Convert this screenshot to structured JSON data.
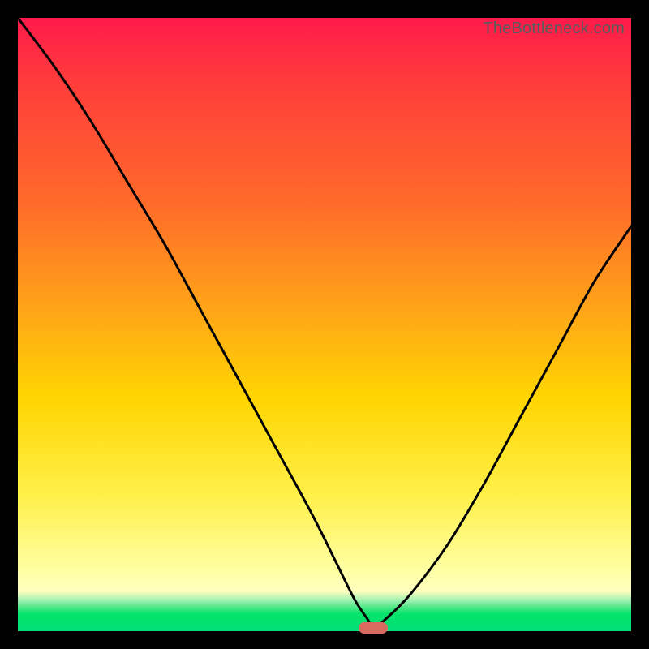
{
  "watermark_text": "TheBottleneck.com",
  "colors": {
    "frame": "#000000",
    "curve": "#000000",
    "marker": "#d96a60",
    "gradient_stops": [
      "#ff1a4b",
      "#ff3b3b",
      "#ff6a2a",
      "#ffa617",
      "#ffd500",
      "#fff04a",
      "#ffffa3",
      "#ffffbe",
      "#9ef0b0",
      "#49e884",
      "#06e46a",
      "#00df78"
    ]
  },
  "chart_data": {
    "type": "line",
    "title": "",
    "xlabel": "",
    "ylabel": "",
    "xlim": [
      0,
      100
    ],
    "ylim": [
      0,
      100
    ],
    "grid": false,
    "legend": false,
    "annotations": {
      "minimum_marker": {
        "x": 58,
        "y": 0.5
      }
    },
    "series": [
      {
        "name": "bottleneck-curve",
        "x": [
          0,
          6,
          12,
          18,
          24,
          30,
          36,
          42,
          48,
          52,
          55,
          57,
          58,
          60,
          64,
          70,
          76,
          82,
          88,
          94,
          100
        ],
        "y": [
          100,
          92,
          83,
          73,
          63,
          52,
          41,
          30,
          19,
          11,
          5,
          2,
          0.5,
          2,
          6,
          14,
          24,
          35,
          46,
          57,
          66
        ]
      }
    ]
  }
}
